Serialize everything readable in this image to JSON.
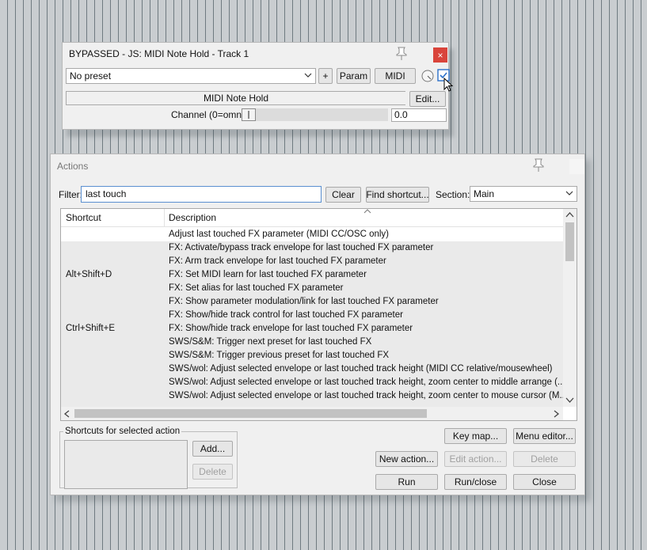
{
  "fx_window": {
    "title": "BYPASSED - JS: MIDI Note Hold - Track 1",
    "close_label": "×",
    "preset_value": "No preset",
    "add_label": "+",
    "param_label": "Param",
    "midi_label": "MIDI",
    "plugin_name": "MIDI Note Hold",
    "edit_label": "Edit...",
    "param_name": "Channel (0=omni)",
    "param_value": "0.0",
    "slider_value": 0
  },
  "actions": {
    "title": "Actions",
    "filter_label": "Filter:",
    "filter_value": "last touch",
    "clear_label": "Clear",
    "find_shortcut_label": "Find shortcut...",
    "section_label": "Section:",
    "section_value": "Main",
    "columns": {
      "shortcut": "Shortcut",
      "description": "Description"
    },
    "rows": [
      {
        "shortcut": "",
        "description": "Adjust last touched FX parameter (MIDI CC/OSC only)"
      },
      {
        "shortcut": "",
        "description": "FX: Activate/bypass track envelope for last touched FX parameter"
      },
      {
        "shortcut": "",
        "description": "FX: Arm track envelope for last touched FX parameter"
      },
      {
        "shortcut": "Alt+Shift+D",
        "description": "FX: Set MIDI learn for last touched FX parameter"
      },
      {
        "shortcut": "",
        "description": "FX: Set alias for last touched FX parameter"
      },
      {
        "shortcut": "",
        "description": "FX: Show parameter modulation/link for last touched FX parameter"
      },
      {
        "shortcut": "",
        "description": "FX: Show/hide track control for last touched FX parameter"
      },
      {
        "shortcut": "Ctrl+Shift+E",
        "description": "FX: Show/hide track envelope for last touched FX parameter"
      },
      {
        "shortcut": "",
        "description": "SWS/S&M: Trigger next preset for last touched FX"
      },
      {
        "shortcut": "",
        "description": "SWS/S&M: Trigger previous preset for last touched FX"
      },
      {
        "shortcut": "",
        "description": "SWS/wol: Adjust selected envelope or last touched track height (MIDI CC relative/mousewheel)"
      },
      {
        "shortcut": "",
        "description": "SWS/wol: Adjust selected envelope or last touched track height, zoom center to middle arrange (..."
      },
      {
        "shortcut": "",
        "description": "SWS/wol: Adjust selected envelope or last touched track height, zoom center to mouse cursor (M..."
      }
    ],
    "group_label": "Shortcuts for selected action",
    "add_label": "Add...",
    "delete_shortcut_label": "Delete",
    "key_map_label": "Key map...",
    "menu_editor_label": "Menu editor...",
    "new_action_label": "New action...",
    "edit_action_label": "Edit action...",
    "delete_label": "Delete",
    "run_label": "Run",
    "run_close_label": "Run/close",
    "close_label": "Close"
  }
}
